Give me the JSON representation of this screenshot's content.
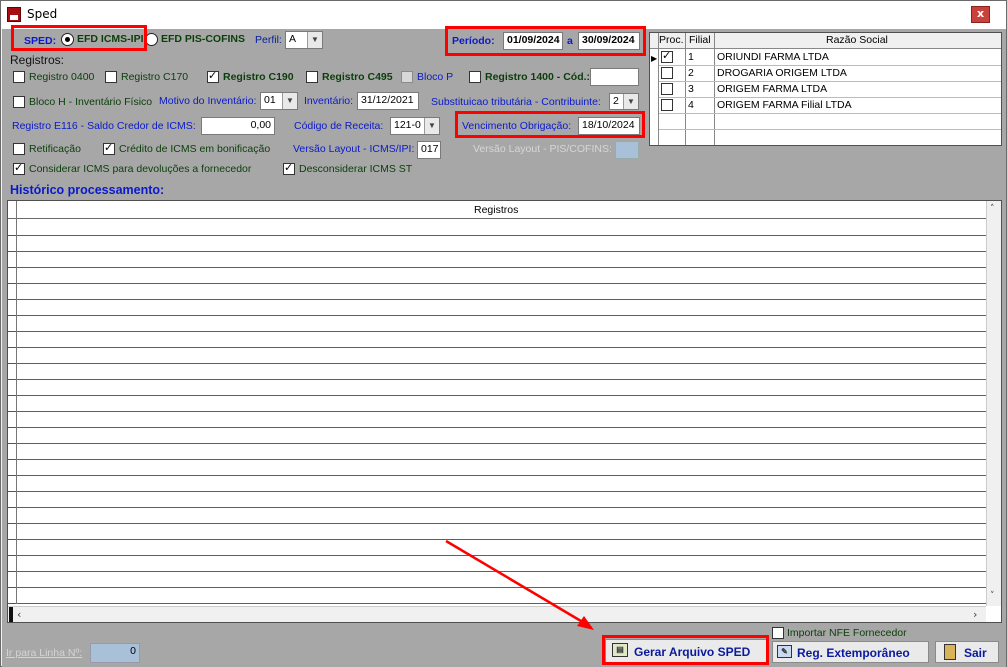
{
  "window": {
    "title": "Sped",
    "close_label": "x"
  },
  "sped": {
    "label": "SPED:",
    "options": [
      "EFD ICMS-IPI",
      "EFD PIS-COFINS"
    ],
    "selected": "EFD ICMS-IPI"
  },
  "perfil": {
    "label": "Perfil:",
    "value": "A"
  },
  "periodo": {
    "label": "Período:",
    "from": "01/09/2024",
    "separator": "a",
    "to": "30/09/2024"
  },
  "registros": {
    "heading": "Registros:",
    "r0400": "Registro 0400",
    "c170": "Registro C170",
    "c190": "Registro C190",
    "c495": "Registro C495",
    "bloco_p": "Bloco P",
    "r1400": "Registro 1400 - Cód.:",
    "r1400_value": ""
  },
  "inventario": {
    "bloco_h": "Bloco H - Inventário Físico",
    "motivo_label": "Motivo do Inventário:",
    "motivo_value": "01",
    "inventario_label": "Inventário:",
    "inventario_value": "31/12/2021",
    "subst_label": "Substituicao tributária - Contribuinte:",
    "subst_value": "2"
  },
  "e116": {
    "label": "Registro E116 - Saldo Credor de ICMS:",
    "value": "0,00",
    "codigo_label": "Código de Receita:",
    "codigo_value": "121-0",
    "venc_label": "Vencimento Obrigação:",
    "venc_value": "18/10/2024"
  },
  "options": {
    "retificacao": "Retificação",
    "credito": "Crédito de ICMS em bonificação",
    "versao_icms_label": "Versão Layout - ICMS/IPI:",
    "versao_icms_value": "017",
    "versao_pis_label": "Versão Layout - PIS/COFINS:",
    "considerar": "Considerar ICMS para devoluções a fornecedor",
    "desconsiderar": "Desconsiderar ICMS ST"
  },
  "filiais": {
    "headers": [
      "Proc.",
      "Filial",
      "Razão Social"
    ],
    "rows": [
      {
        "proc": true,
        "filial": "1",
        "razao": "ORIUNDI FARMA LTDA"
      },
      {
        "proc": false,
        "filial": "2",
        "razao": "DROGARIA ORIGEM LTDA"
      },
      {
        "proc": false,
        "filial": "3",
        "razao": "ORIGEM FARMA LTDA"
      },
      {
        "proc": false,
        "filial": "4",
        "razao": "ORIGEM FARMA Filial LTDA"
      }
    ]
  },
  "historico": {
    "heading": "Histórico processamento:",
    "column": "Registros"
  },
  "footer": {
    "ir_linha_label": "Ir para Linha Nº:",
    "ir_linha_value": "0",
    "importar_nfe": "Importar NFE Fornecedor",
    "gerar": "Gerar Arquivo SPED",
    "reg_extemp": "Reg. Extemporâneo",
    "sair": "Sair"
  },
  "colors": {
    "highlight": "#ff0000",
    "label_blue": "#0a1acb",
    "label_green": "#0b3e0b",
    "grid_line": "#2b6ea5"
  },
  "icons": [
    "sped-app-icon",
    "close-icon",
    "radio-icon",
    "checkbox-icon",
    "chevron-down-icon",
    "scroll-up-icon",
    "scroll-down-icon",
    "scroll-left-icon",
    "scroll-right-icon",
    "file-generate-icon",
    "register-edit-icon",
    "exit-door-icon",
    "red-arrow-annotation"
  ]
}
